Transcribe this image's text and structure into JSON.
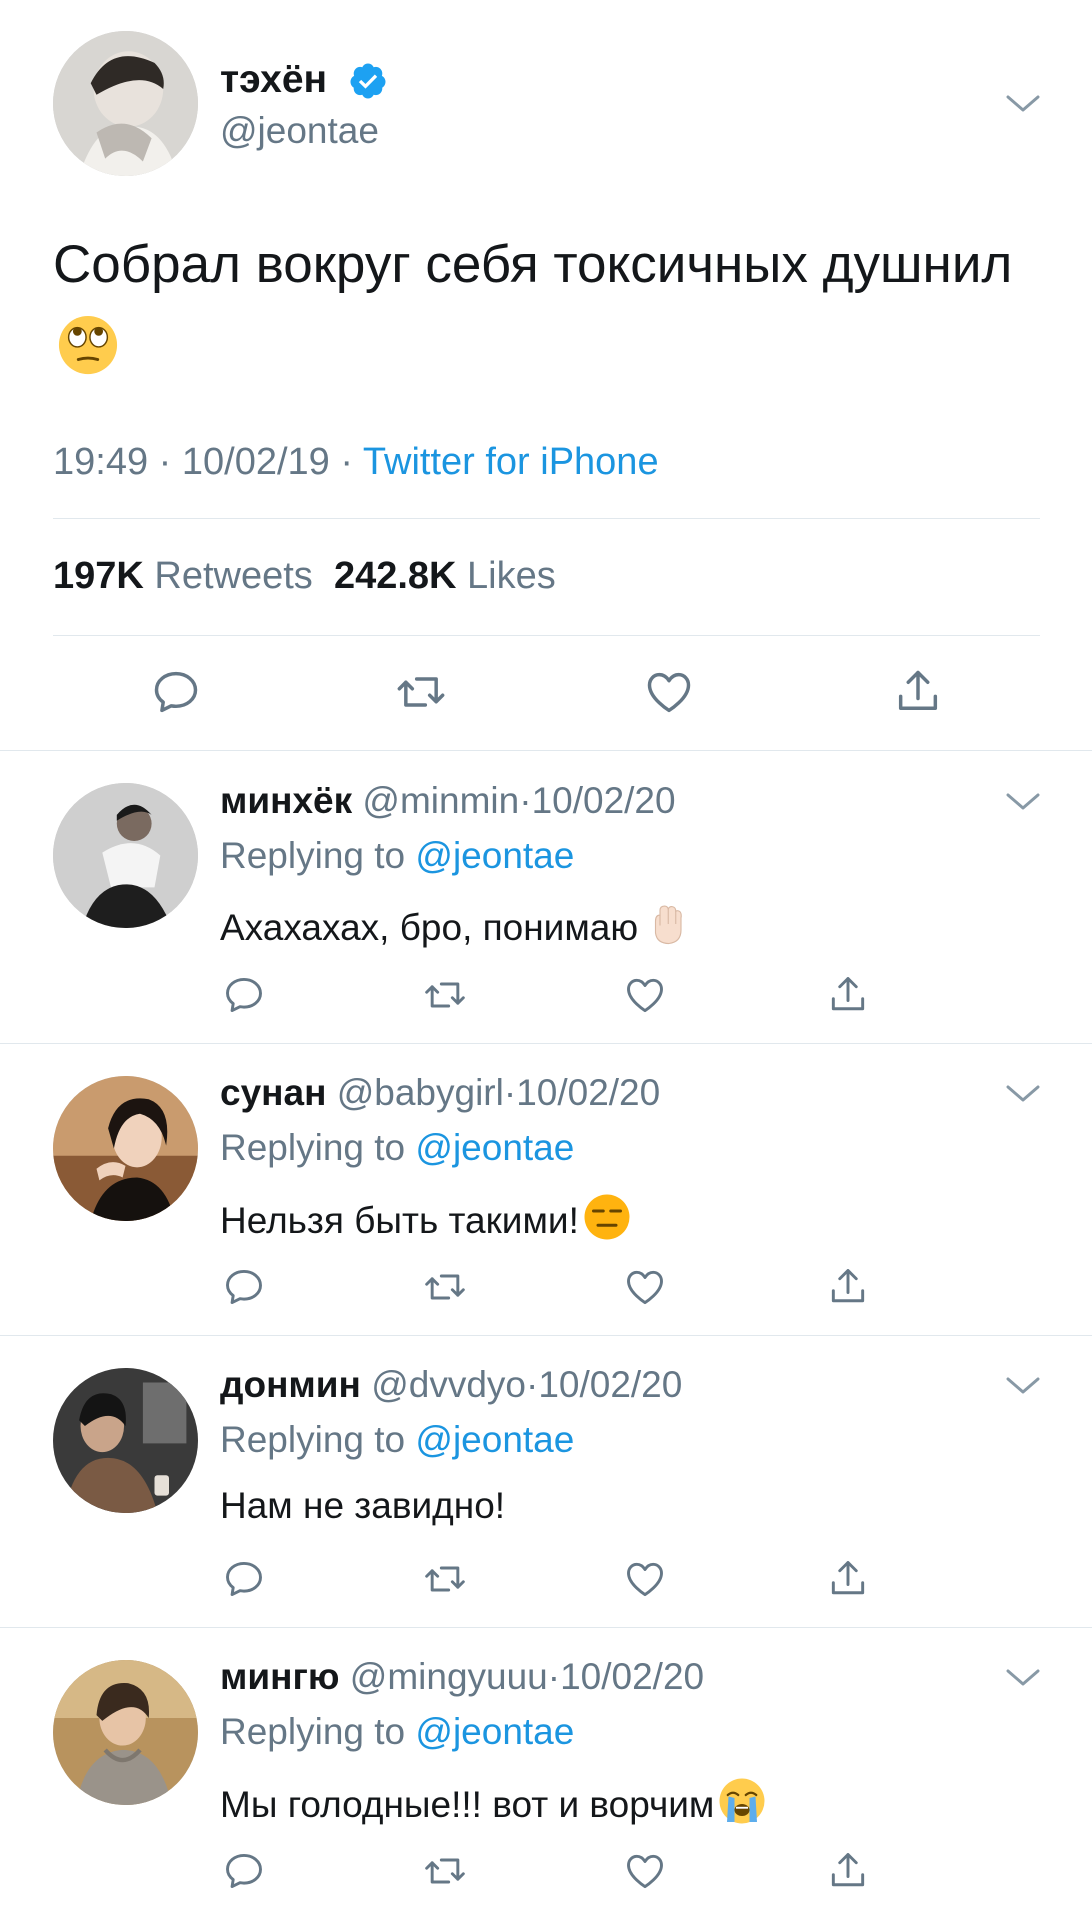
{
  "main_tweet": {
    "name": "тэхён",
    "handle": "@jeontae",
    "text": "Собрал вокруг себя токсичных душнил",
    "text_emoji": "face-with-rolling-eyes",
    "time": "19:49",
    "date": "10/02/19",
    "separator": "·",
    "source": "Twitter for iPhone",
    "retweets_count": "197K",
    "retweets_label": "Retweets",
    "likes_count": "242.8K",
    "likes_label": "Likes"
  },
  "replies": [
    {
      "name": "минхёк",
      "handle": "@minmin",
      "date": "10/02/20",
      "replying_label": "Replying to",
      "replying_to": "@jeontae",
      "text": "Ахахахах, бро, понимаю",
      "emoji": "raised-fist"
    },
    {
      "name": "сунан",
      "handle": "@babygirl",
      "date": "10/02/20",
      "replying_label": "Replying to",
      "replying_to": "@jeontae",
      "text": "Нельзя быть такими!",
      "emoji": "expressionless-face"
    },
    {
      "name": "донмин",
      "handle": "@dvvdyo",
      "date": "10/02/20",
      "replying_label": "Replying to",
      "replying_to": "@jeontae",
      "text": "Нам не завидно!",
      "emoji": ""
    },
    {
      "name": "мингю",
      "handle": "@mingyuuu",
      "date": "10/02/20",
      "replying_label": "Replying to",
      "replying_to": "@jeontae",
      "text": "Мы голодные!!! вот и ворчим",
      "emoji": "loudly-crying-face"
    }
  ],
  "colors": {
    "link": "#1b95e0",
    "secondary_text": "#657786",
    "primary_text": "#14171a",
    "divider": "#e1e8ed",
    "verified": "#1da1f2"
  }
}
